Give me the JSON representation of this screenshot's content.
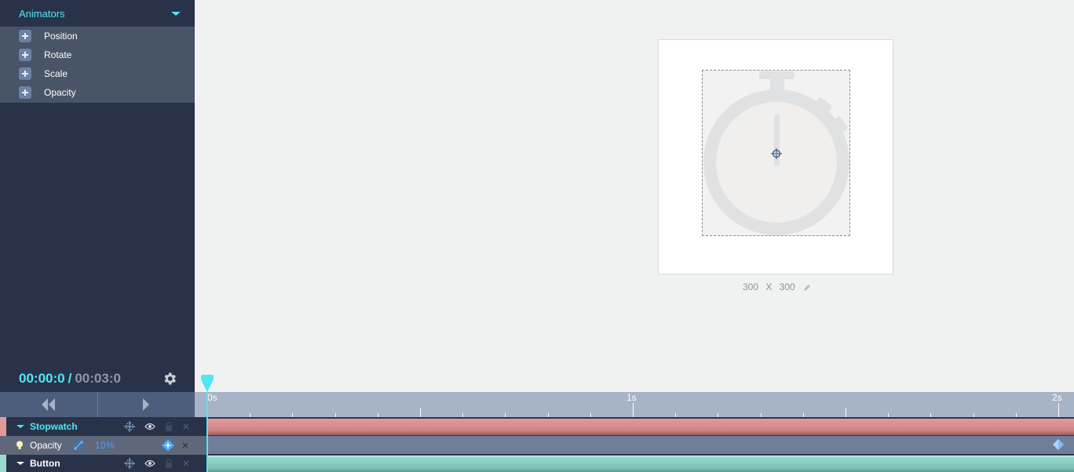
{
  "sidebar": {
    "animators": {
      "title": "Animators",
      "items": [
        {
          "label": "Position",
          "icon": "plus-icon"
        },
        {
          "label": "Rotate",
          "icon": "plus-icon"
        },
        {
          "label": "Scale",
          "icon": "plus-icon"
        },
        {
          "label": "Opacity",
          "icon": "plus-icon"
        }
      ]
    },
    "time": {
      "current": "00:00:0",
      "separator": "/",
      "total": "00:03:0"
    }
  },
  "canvas": {
    "width": "300",
    "times": "X",
    "height": "300",
    "object": "stopwatch"
  },
  "timeline": {
    "ruler": {
      "labels": [
        "0s",
        "1s",
        "2s"
      ]
    },
    "layers": [
      {
        "name": "Stopwatch",
        "color": "#e09a9a",
        "track_color": "#d98d8d",
        "expanded": true
      },
      {
        "name": "Button",
        "color": "#9ad9ce",
        "track_color": "#8fd3c6",
        "expanded": true
      }
    ],
    "property": {
      "name": "Opacity",
      "value": "10%",
      "keyframe_time_s": 2.0
    },
    "playhead_s": 0.0
  },
  "colors": {
    "accent": "#4de8f3",
    "sidebar_bg": "#28334a",
    "ruler_bg": "#a7b3c6"
  }
}
